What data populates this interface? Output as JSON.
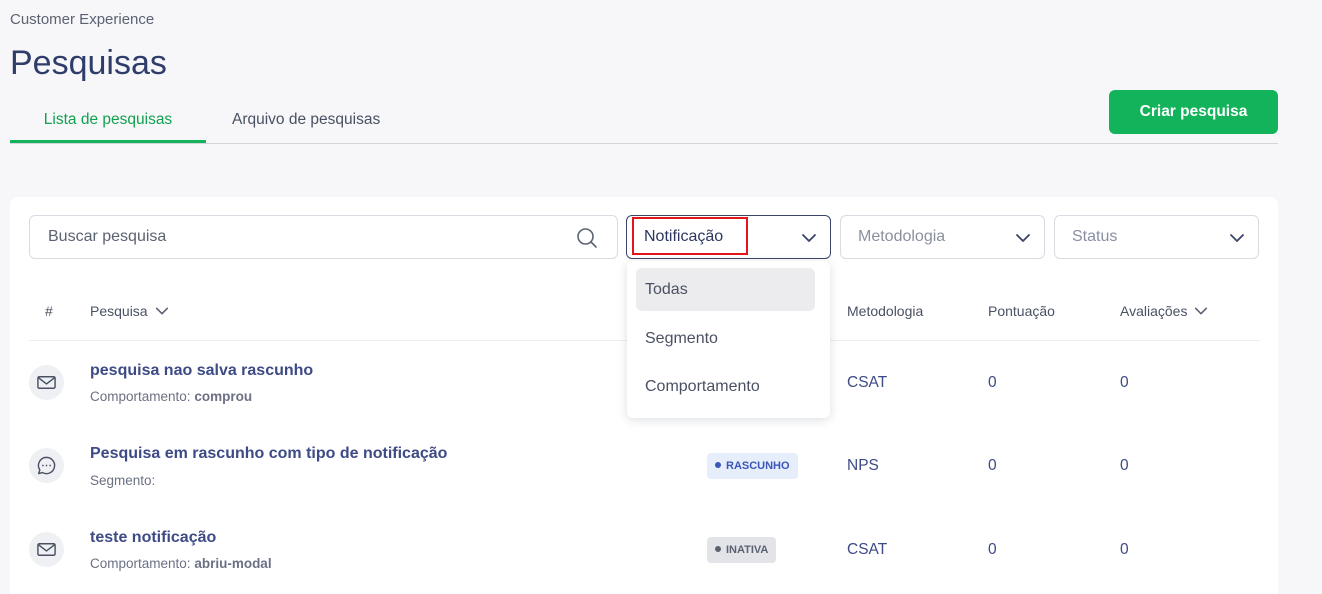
{
  "header": {
    "breadcrumb": "Customer Experience",
    "title": "Pesquisas",
    "create_button": "Criar pesquisa"
  },
  "tabs": [
    {
      "label": "Lista de pesquisas",
      "active": true
    },
    {
      "label": "Arquivo de pesquisas",
      "active": false
    }
  ],
  "filters": {
    "search_placeholder": "Buscar pesquisa",
    "notification": {
      "selected": "Notificação",
      "options": [
        "Todas",
        "Segmento",
        "Comportamento"
      ],
      "highlighted_option": "Todas",
      "open": true
    },
    "methodology_placeholder": "Metodologia",
    "status_placeholder": "Status"
  },
  "table": {
    "columns": [
      "#",
      "Pesquisa",
      "Metodologia",
      "Pontuação",
      "Avaliações"
    ],
    "rows": [
      {
        "icon": "mail-icon",
        "title": "pesquisa nao salva rascunho",
        "sub_label": "Comportamento:",
        "sub_value": "comprou",
        "status": "",
        "methodology": "CSAT",
        "score": "0",
        "reviews": "0"
      },
      {
        "icon": "chat-bubble-icon",
        "title": "Pesquisa em rascunho com tipo de notificação",
        "sub_label": "Segmento:",
        "sub_value": "",
        "status": "RASCUNHO",
        "methodology": "NPS",
        "score": "0",
        "reviews": "0"
      },
      {
        "icon": "mail-icon",
        "title": "teste notificação",
        "sub_label": "Comportamento:",
        "sub_value": "abriu-modal",
        "status": "INATIVA",
        "methodology": "CSAT",
        "score": "0",
        "reviews": "0"
      }
    ]
  },
  "colors": {
    "accent_green": "#12b35a",
    "title_navy": "#2f3d6b",
    "link_navy": "#3d4a85",
    "highlight_red": "#e3141b"
  }
}
